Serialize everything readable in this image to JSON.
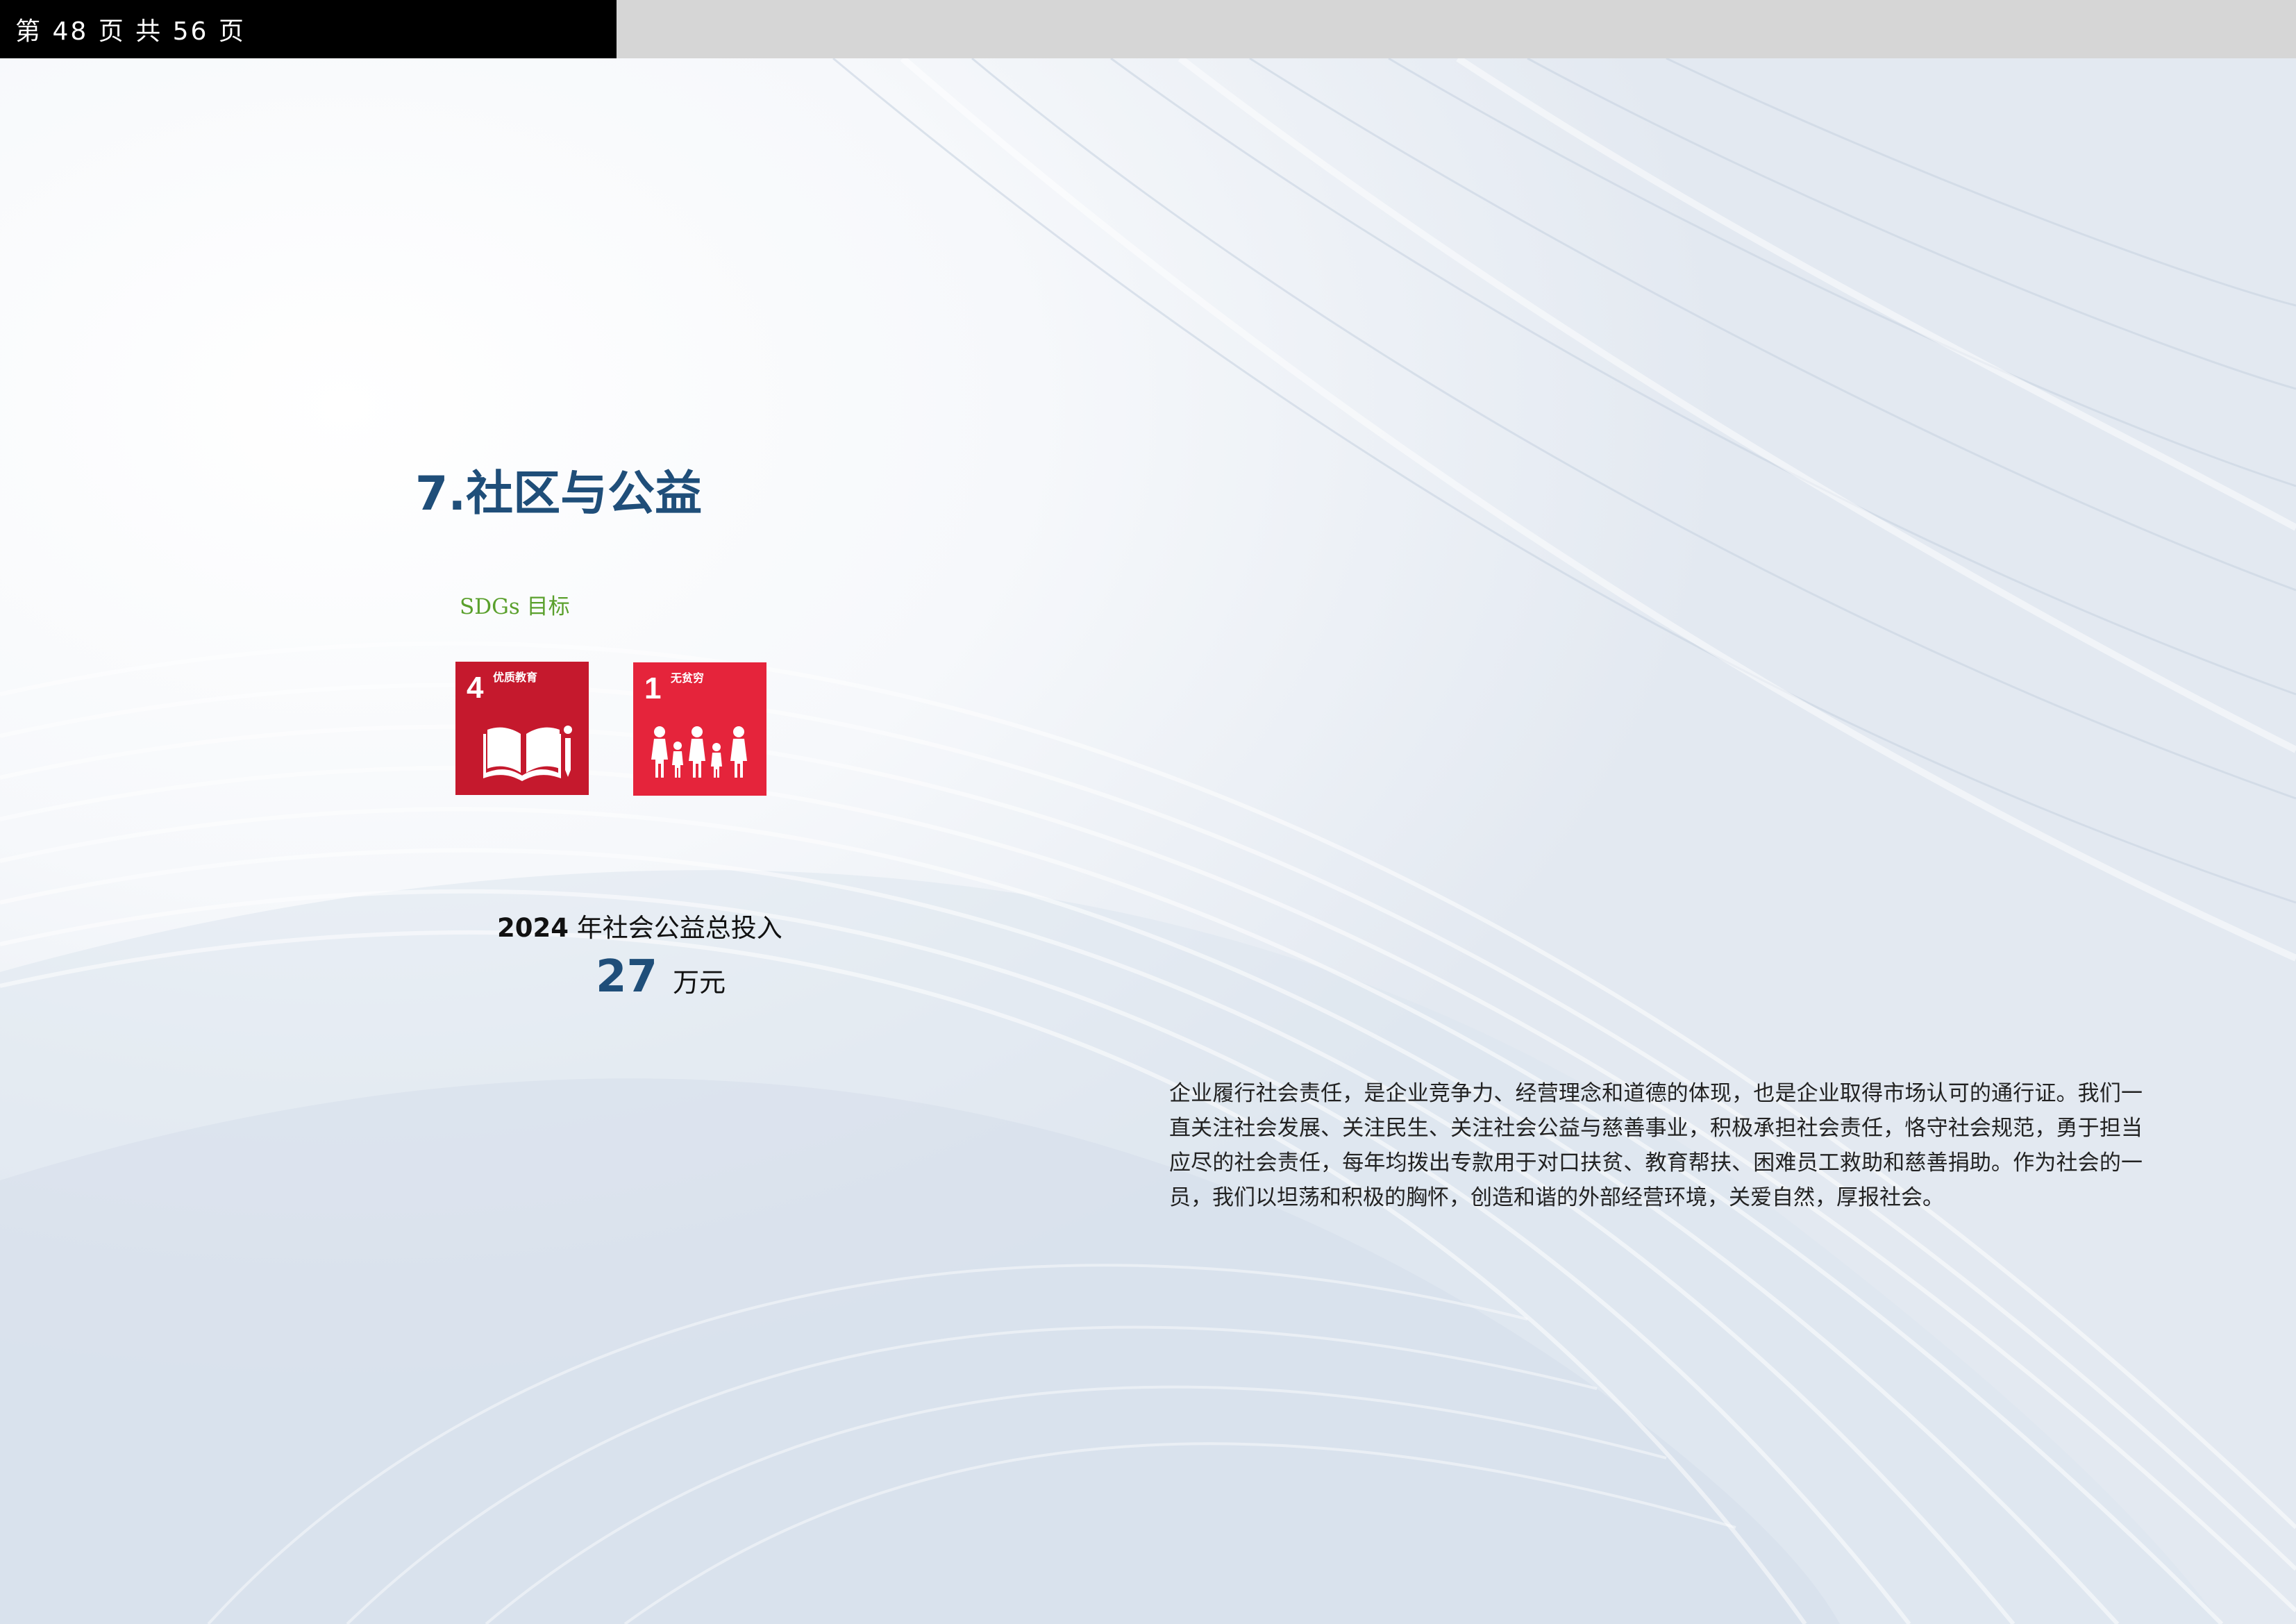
{
  "header": {
    "page_indicator": "第 48 页 共 56 页"
  },
  "section": {
    "title": "7.社区与公益"
  },
  "sdg": {
    "label": "SDGs 目标",
    "goals": [
      {
        "number": "4",
        "title": "优质教育",
        "color": "#c5192d",
        "icon": "book-pencil-icon"
      },
      {
        "number": "1",
        "title": "无贫穷",
        "color": "#e5243b",
        "icon": "family-icon"
      }
    ]
  },
  "investment": {
    "year": "2024",
    "caption": "年社会公益总投入",
    "value": "27",
    "unit": "万元"
  },
  "body": {
    "paragraph": "企业履行社会责任，是企业竞争力、经营理念和道德的体现，也是企业取得市场认可的通行证。我们一直关注社会发展、关注民生、关注社会公益与慈善事业，积极承担社会责任，恪守社会规范，勇于担当应尽的社会责任，每年均拨出专款用于对口扶贫、教育帮扶、困难员工救助和慈善捐助。作为社会的一员，我们以坦荡和积极的胸怀，创造和谐的外部经营环境，关爱自然，厚报社会。"
  },
  "colors": {
    "title_blue": "#1f4e79",
    "sdg_green": "#5aa02c",
    "header_black": "#000000",
    "header_gray": "#d6d6d6"
  }
}
